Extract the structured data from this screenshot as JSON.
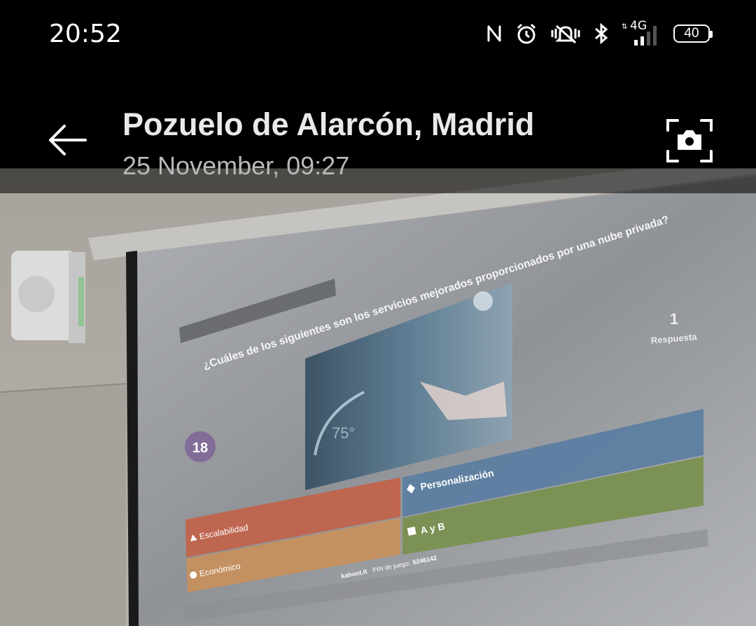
{
  "status_bar": {
    "time": "20:52",
    "network": "4G",
    "battery": "40",
    "icons": [
      "nfc-icon",
      "alarm-icon",
      "vibrate-icon",
      "bluetooth-icon",
      "signal-icon",
      "battery-icon"
    ]
  },
  "header": {
    "title": "Pozuelo de Alarcón, Madrid",
    "subtitle": "25 November, 09:27"
  },
  "photo": {
    "question": "¿Cuáles de los siguientes son los servicios mejorados proporcionados por una nube privada?",
    "timer": "18",
    "answers_count": "1",
    "answers_label": "Respuesta",
    "answers": [
      {
        "label": "Escalabilidad",
        "color": "#c2624a"
      },
      {
        "label": "Personalización",
        "color": "#5a7ea2"
      },
      {
        "label": "Económico",
        "color": "#c8905c"
      },
      {
        "label": "A y B",
        "color": "#78904e"
      }
    ],
    "footer": {
      "site": "kahoot.it",
      "pin_label": "PIN de juego:",
      "pin": "5246142"
    },
    "image_overlay": "75°"
  }
}
